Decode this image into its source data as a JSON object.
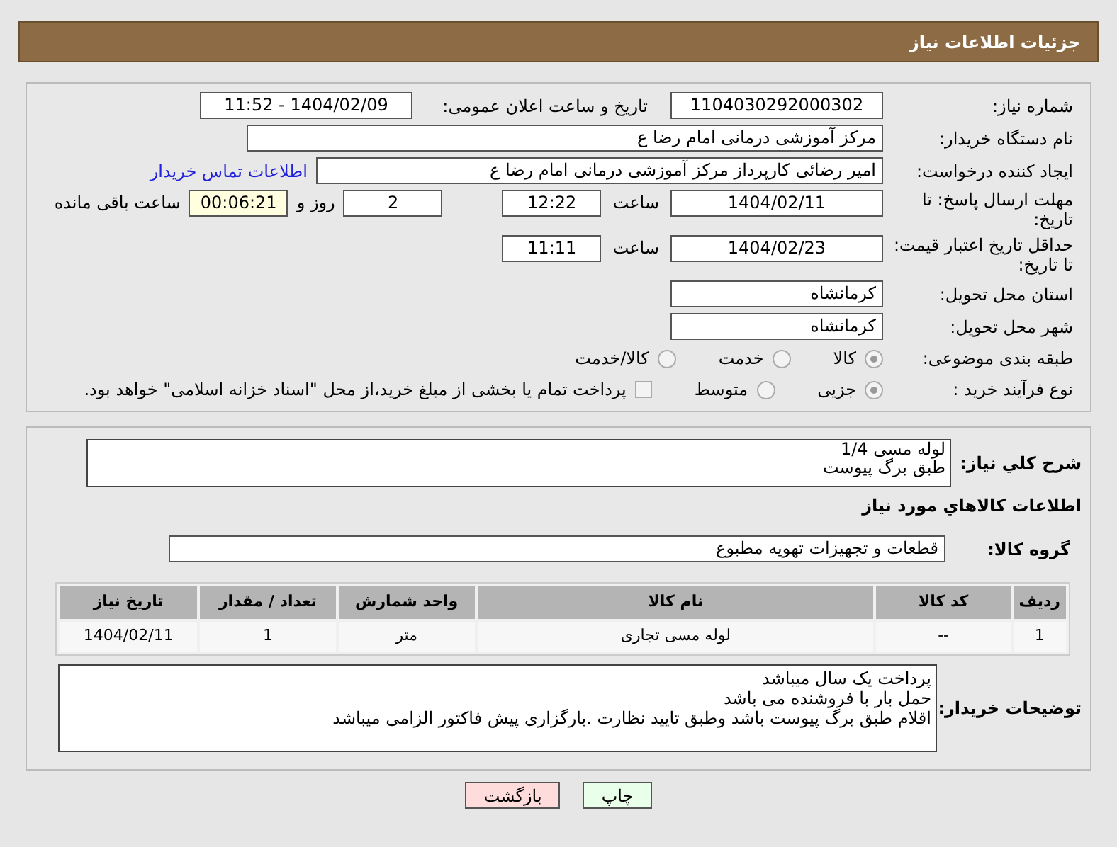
{
  "header": {
    "title": "جزئیات اطلاعات نیاز"
  },
  "need_number": {
    "label": "شماره نیاز:",
    "value": "1104030292000302"
  },
  "announce": {
    "label": "تاریخ و ساعت اعلان عمومی:",
    "value": "1404/02/09 - 11:52"
  },
  "buyer_org": {
    "label": "نام دستگاه خریدار:",
    "value": "مرکز آموزشی  درمانی امام رضا  ع"
  },
  "creator": {
    "label": "ایجاد کننده درخواست:",
    "value": "امیر رضائی کارپرداز مرکز آموزشی  درمانی امام رضا  ع",
    "link": "اطلاعات تماس خریدار"
  },
  "deadline": {
    "label": "مهلت ارسال پاسخ: تا تاریخ:",
    "date": "1404/02/11",
    "time_label": "ساعت",
    "time": "12:22",
    "days": "2",
    "days_label": "روز و",
    "remaining": "00:06:21",
    "remaining_label": "ساعت باقی مانده"
  },
  "validity": {
    "label": "حداقل تاریخ اعتبار قیمت: تا تاریخ:",
    "date": "1404/02/23",
    "time_label": "ساعت",
    "time": "11:11"
  },
  "province": {
    "label": "استان محل تحویل:",
    "value": "کرمانشاه"
  },
  "city": {
    "label": "شهر محل تحویل:",
    "value": "کرمانشاه"
  },
  "category": {
    "label": "طبقه بندی موضوعی:",
    "options": [
      {
        "label": "کالا",
        "selected": true
      },
      {
        "label": "خدمت",
        "selected": false
      },
      {
        "label": "کالا/خدمت",
        "selected": false
      }
    ]
  },
  "purchase_type": {
    "label": "نوع فرآیند خرید :",
    "options": [
      {
        "label": "جزیی",
        "selected": true
      },
      {
        "label": "متوسط",
        "selected": false
      }
    ],
    "payment_note": {
      "label": "پرداخت تمام یا بخشی از مبلغ خرید،از محل \"اسناد خزانه اسلامی\" خواهد بود.",
      "checked": false
    }
  },
  "summary": {
    "label": "شرح کلي نياز:",
    "lines": [
      "لوله مسی 1/4",
      "طبق برگ پیوست"
    ]
  },
  "goods_title": "اطلاعات کالاهاي مورد نياز",
  "goods_group": {
    "label": "گروه کالا:",
    "value": "قطعات و تجهیزات تهویه مطبوع"
  },
  "table": {
    "columns": [
      "ردیف",
      "کد کالا",
      "نام کالا",
      "واحد شمارش",
      "تعداد / مقدار",
      "تاریخ نیاز"
    ],
    "rows": [
      [
        "1",
        "--",
        "لوله مسی تجاری",
        "متر",
        "1",
        "1404/02/11"
      ]
    ]
  },
  "buyer_notes": {
    "label": "توضیحات خریدار:",
    "lines": [
      "پرداخت یک سال میباشد",
      "حمل بار با فروشنده می باشد",
      "اقلام طبق برگ پیوست باشد وطبق تایید نظارت .بارگزاری پیش فاکتور الزامی میباشد"
    ]
  },
  "buttons": [
    {
      "label": "چاپ",
      "kind": "print"
    },
    {
      "label": "بازگشت",
      "kind": "back"
    }
  ]
}
